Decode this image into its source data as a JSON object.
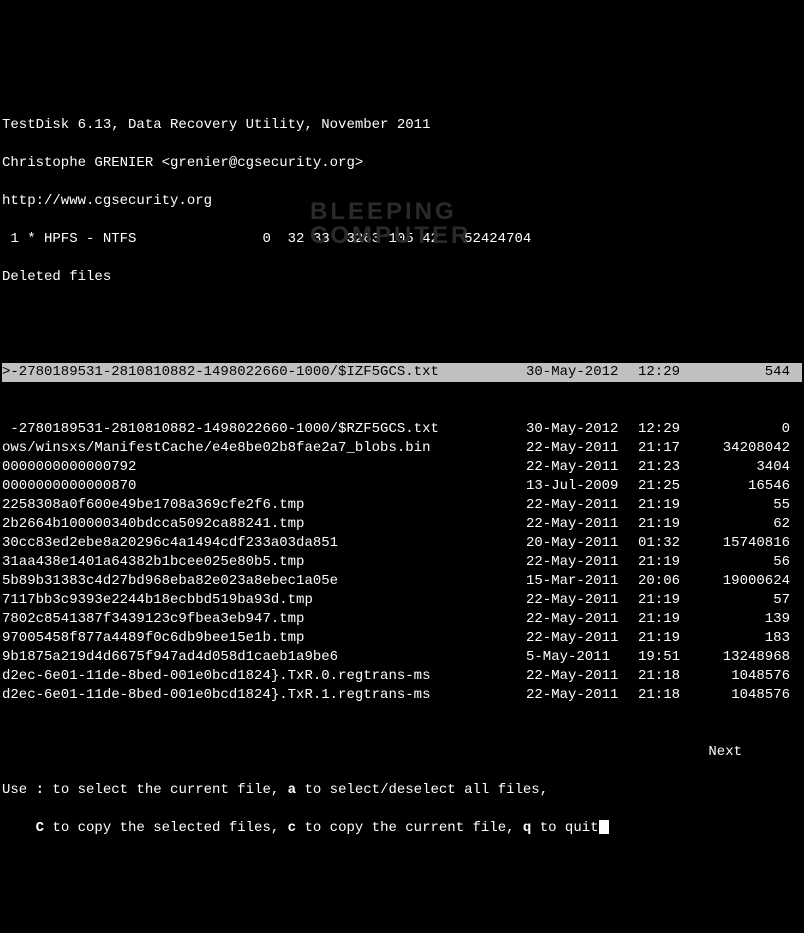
{
  "header": {
    "title": "TestDisk 6.13, Data Recovery Utility, November 2011",
    "author": "Christophe GRENIER <grenier@cgsecurity.org>",
    "url": "http://www.cgsecurity.org",
    "partition": " 1 * HPFS - NTFS               0  32 33  3263 105 42   52424704",
    "mode": "Deleted files"
  },
  "selected": {
    "name": ">-2780189531-2810810882-1498022660-1000/$IZF5GCS.txt",
    "date": "30-May-2012",
    "time": "12:29",
    "size": "544"
  },
  "files": [
    {
      "name": " -2780189531-2810810882-1498022660-1000/$RZF5GCS.txt",
      "date": "30-May-2012",
      "time": "12:29",
      "size": "0"
    },
    {
      "name": "ows/winsxs/ManifestCache/e4e8be02b8fae2a7_blobs.bin",
      "date": "22-May-2011",
      "time": "21:17",
      "size": "34208042"
    },
    {
      "name": "0000000000000792",
      "date": "22-May-2011",
      "time": "21:23",
      "size": "3404"
    },
    {
      "name": "0000000000000870",
      "date": "13-Jul-2009",
      "time": "21:25",
      "size": "16546"
    },
    {
      "name": "2258308a0f600e49be1708a369cfe2f6.tmp",
      "date": "22-May-2011",
      "time": "21:19",
      "size": "55"
    },
    {
      "name": "2b2664b100000340bdcca5092ca88241.tmp",
      "date": "22-May-2011",
      "time": "21:19",
      "size": "62"
    },
    {
      "name": "30cc83ed2ebe8a20296c4a1494cdf233a03da851",
      "date": "20-May-2011",
      "time": "01:32",
      "size": "15740816"
    },
    {
      "name": "31aa438e1401a64382b1bcee025e80b5.tmp",
      "date": "22-May-2011",
      "time": "21:19",
      "size": "56"
    },
    {
      "name": "5b89b31383c4d27bd968eba82e023a8ebec1a05e",
      "date": "15-Mar-2011",
      "time": "20:06",
      "size": "19000624"
    },
    {
      "name": "7117bb3c9393e2244b18ecbbd519ba93d.tmp",
      "date": "22-May-2011",
      "time": "21:19",
      "size": "57"
    },
    {
      "name": "7802c8541387f3439123c9fbea3eb947.tmp",
      "date": "22-May-2011",
      "time": "21:19",
      "size": "139"
    },
    {
      "name": "97005458f877a4489f0c6db9bee15e1b.tmp",
      "date": "22-May-2011",
      "time": "21:19",
      "size": "183"
    },
    {
      "name": "9b1875a219d4d6675f947ad4d058d1caeb1a9be6",
      "date": "5-May-2011",
      "time": "19:51",
      "size": "13248968"
    },
    {
      "name": "d2ec-6e01-11de-8bed-001e0bcd1824}.TxR.0.regtrans-ms",
      "date": "22-May-2011",
      "time": "21:18",
      "size": "1048576"
    },
    {
      "name": "d2ec-6e01-11de-8bed-001e0bcd1824}.TxR.1.regtrans-ms",
      "date": "22-May-2011",
      "time": "21:18",
      "size": "1048576"
    }
  ],
  "footer": {
    "next": "Next",
    "help1_a": "Use ",
    "help1_b": ":",
    "help1_c": " to select the current file, ",
    "help1_d": "a",
    "help1_e": " to select/deselect all files,",
    "help2_a": "    ",
    "help2_b": "C",
    "help2_c": " to copy the selected files, ",
    "help2_d": "c",
    "help2_e": " to copy the current file, ",
    "help2_f": "q",
    "help2_g": " to quit"
  },
  "watermark": {
    "line1": "BLEEPING",
    "line2": "COMPUTER"
  }
}
